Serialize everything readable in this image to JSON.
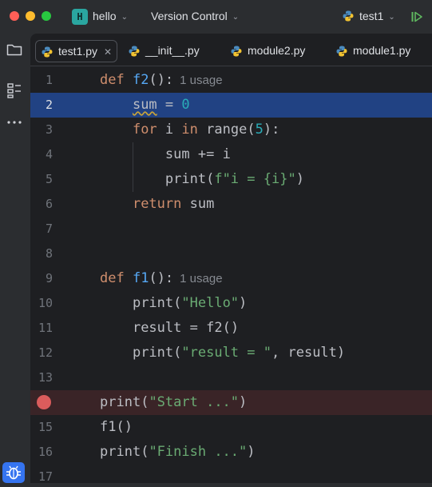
{
  "titlebar": {
    "project_badge": "H",
    "project_name": "hello",
    "vcs_label": "Version Control",
    "run_config": "test1"
  },
  "tabs": [
    {
      "label": "test1.py",
      "active": true
    },
    {
      "label": "__init__.py"
    },
    {
      "label": "module2.py"
    },
    {
      "label": "module1.py"
    }
  ],
  "editor": {
    "current_line": 2,
    "breakpoint_line": 14,
    "lines": [
      {
        "n": "1",
        "code": "def f2():",
        "hint": "1 usage"
      },
      {
        "n": "2",
        "code": "    sum = 0"
      },
      {
        "n": "3",
        "code": "    for i in range(5):"
      },
      {
        "n": "4",
        "code": "        sum += i"
      },
      {
        "n": "5",
        "code": "        print(f\"i = {i}\")"
      },
      {
        "n": "6",
        "code": "    return sum"
      },
      {
        "n": "7",
        "code": ""
      },
      {
        "n": "8",
        "code": ""
      },
      {
        "n": "9",
        "code": "def f1():",
        "hint": "1 usage"
      },
      {
        "n": "10",
        "code": "    print(\"Hello\")"
      },
      {
        "n": "11",
        "code": "    result = f2()"
      },
      {
        "n": "12",
        "code": "    print(\"result = \", result)"
      },
      {
        "n": "13",
        "code": ""
      },
      {
        "n": "",
        "code": "print(\"Start ...\")"
      },
      {
        "n": "15",
        "code": "f1()"
      },
      {
        "n": "16",
        "code": "print(\"Finish ...\")"
      },
      {
        "n": "17",
        "code": ""
      }
    ]
  },
  "icons": {
    "project": "folder-icon",
    "structure": "structure-icon",
    "more": "more-icon",
    "debug": "bug-icon",
    "run_config": "python-run-config-icon",
    "run": "run-icon"
  },
  "colors": {
    "current_line": "#214283",
    "breakpoint": "#db5c5c",
    "keyword": "#cf8e6d",
    "function": "#56a8f5",
    "string": "#6aab73",
    "number": "#2aacb8"
  }
}
